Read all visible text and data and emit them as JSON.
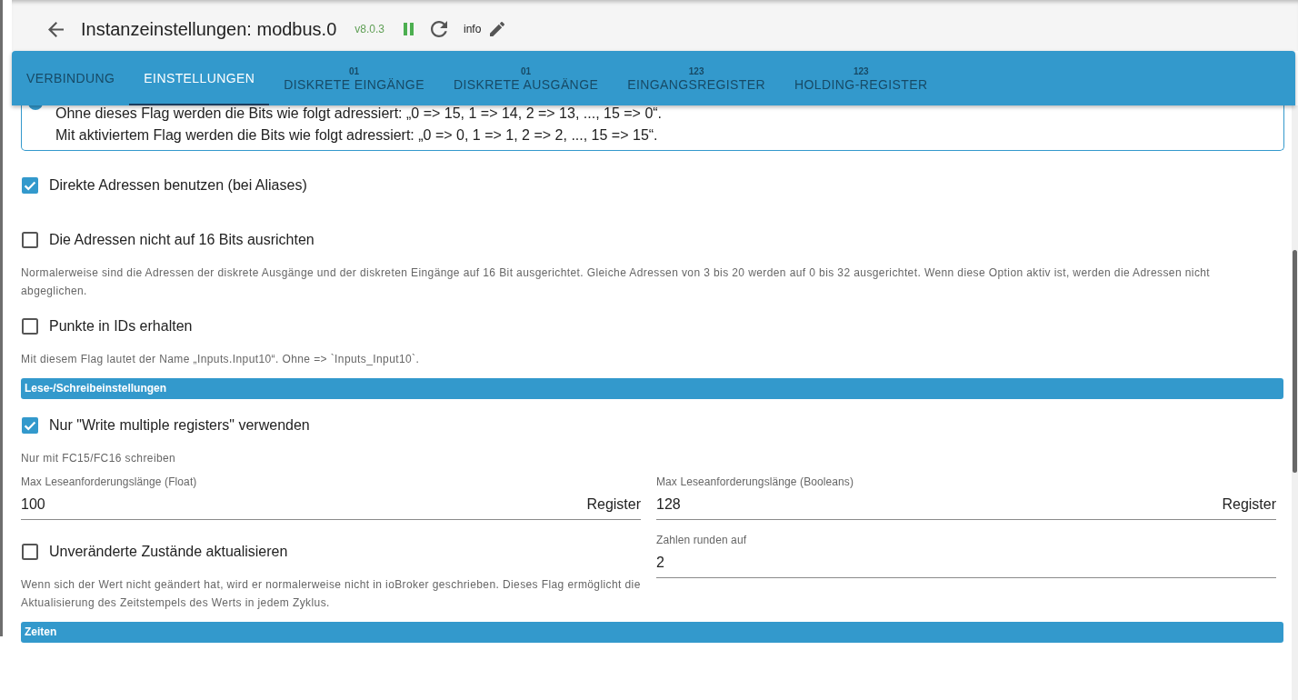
{
  "header": {
    "title": "Instanzeinstellungen: modbus.0",
    "version": "v8.0.3",
    "running": true,
    "info_label": "info"
  },
  "tabs": [
    {
      "label": "VERBINDUNG",
      "selected": false
    },
    {
      "label": "EINSTELLUNGEN",
      "selected": true
    },
    {
      "badge": "01",
      "label": "DISKRETE EINGÄNGE",
      "selected": false
    },
    {
      "badge": "01",
      "label": "DISKRETE AUSGÄNGE",
      "selected": false
    },
    {
      "badge": "123",
      "label": "EINGANGSREGISTER",
      "selected": false
    },
    {
      "badge": "123",
      "label": "HOLDING-REGISTER",
      "selected": false
    }
  ],
  "info_box": {
    "lines": [
      "Ohne dieses Flag werden die Bits wie folgt adressiert: „0 => 15, 1 => 14, 2 => 13, ..., 15 => 0“.",
      "Mit aktiviertem Flag werden die Bits wie folgt adressiert: „0 => 0, 1 => 1, 2 => 2, ..., 15 => 15“."
    ]
  },
  "items": [
    {
      "kind": "checkbox",
      "label": "Direkte Adressen benutzen (bei Aliases)",
      "checked": true
    },
    {
      "kind": "checkbox",
      "label": "Die Adressen nicht auf 16 Bits ausrichten",
      "checked": false,
      "help": "Normalerweise sind die Adressen der diskrete Ausgänge und der diskreten Eingänge auf 16 Bit ausgerichtet. Gleiche Adressen von 3 bis 20 werden auf 0 bis 32 ausgerichtet. Wenn diese Option aktiv ist, werden die Adressen nicht abgeglichen."
    },
    {
      "kind": "checkbox",
      "label": "Punkte in IDs erhalten",
      "checked": false,
      "help": "Mit diesem Flag lautet der Name „Inputs.Input10“. Ohne => `Inputs_Input10`."
    },
    {
      "kind": "section",
      "title": "Lese-/Schreibeinstellungen"
    },
    {
      "kind": "checkbox",
      "label": "Nur \"Write multiple registers\" verwenden",
      "checked": true,
      "help": "Nur mit FC15/FC16 schreiben"
    },
    {
      "kind": "columns",
      "left": [
        {
          "kind": "field",
          "label": "Max Leseanforderungslänge (Float)",
          "value": "100",
          "unit": "Register"
        },
        {
          "kind": "checkbox",
          "label": "Unveränderte Zustände aktualisieren",
          "checked": false,
          "help": "Wenn sich der Wert nicht geändert hat, wird er normalerweise nicht in ioBroker geschrieben. Dieses Flag ermöglicht die Aktualisierung des Zeitstempels des Werts in jedem Zyklus."
        }
      ],
      "right": [
        {
          "kind": "field",
          "label": "Max Leseanforderungslänge (Booleans)",
          "value": "128",
          "unit": "Register"
        },
        {
          "kind": "field",
          "label": "Zahlen runden auf",
          "value": "2"
        }
      ]
    },
    {
      "kind": "section",
      "title": "Zeiten"
    }
  ]
}
